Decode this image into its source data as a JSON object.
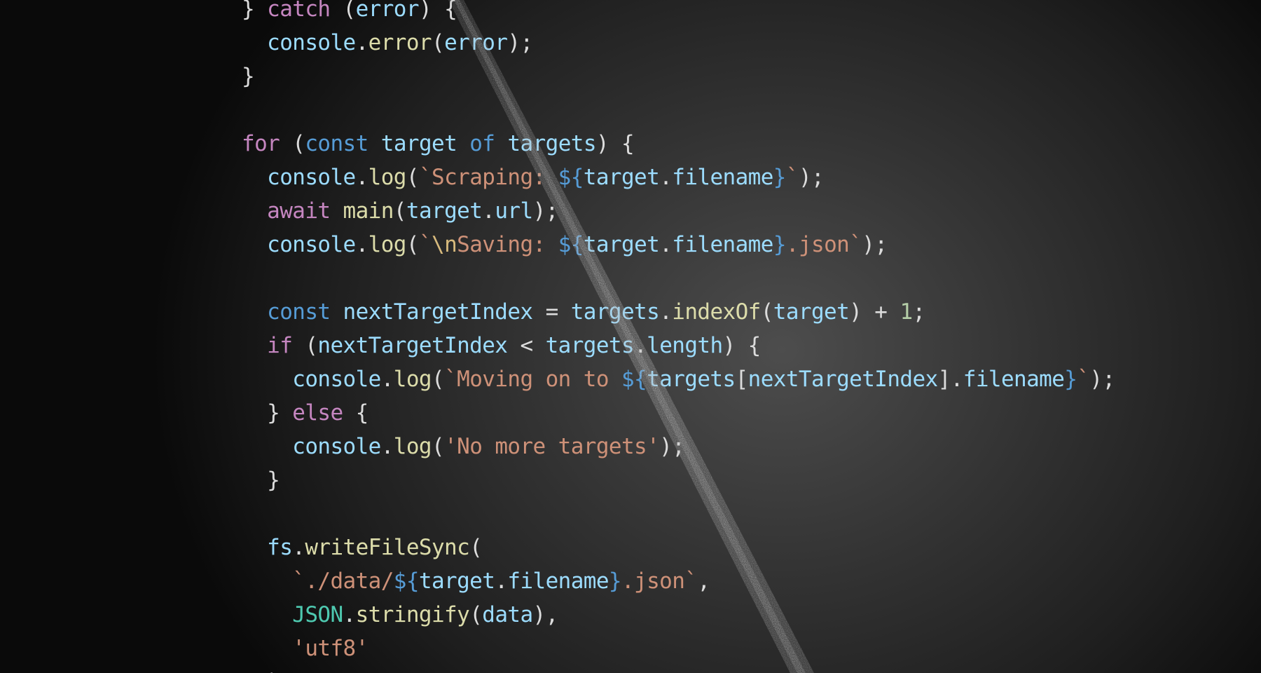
{
  "code_lines": [
    [
      {
        "t": "} ",
        "c": "plain"
      },
      {
        "t": "catch",
        "c": "kw"
      },
      {
        "t": " (",
        "c": "plain"
      },
      {
        "t": "error",
        "c": "var"
      },
      {
        "t": ") {",
        "c": "plain"
      }
    ],
    [
      {
        "t": "  ",
        "c": "plain"
      },
      {
        "t": "console",
        "c": "var"
      },
      {
        "t": ".",
        "c": "plain"
      },
      {
        "t": "error",
        "c": "fn"
      },
      {
        "t": "(",
        "c": "plain"
      },
      {
        "t": "error",
        "c": "var"
      },
      {
        "t": ");",
        "c": "plain"
      }
    ],
    [
      {
        "t": "}",
        "c": "plain"
      }
    ],
    [],
    [
      {
        "t": "for",
        "c": "kw"
      },
      {
        "t": " (",
        "c": "plain"
      },
      {
        "t": "const",
        "c": "decl"
      },
      {
        "t": " ",
        "c": "plain"
      },
      {
        "t": "target",
        "c": "var"
      },
      {
        "t": " ",
        "c": "plain"
      },
      {
        "t": "of",
        "c": "decl"
      },
      {
        "t": " ",
        "c": "plain"
      },
      {
        "t": "targets",
        "c": "var"
      },
      {
        "t": ") {",
        "c": "plain"
      }
    ],
    [
      {
        "t": "  ",
        "c": "plain"
      },
      {
        "t": "console",
        "c": "var"
      },
      {
        "t": ".",
        "c": "plain"
      },
      {
        "t": "log",
        "c": "fn"
      },
      {
        "t": "(",
        "c": "plain"
      },
      {
        "t": "`Scraping: ",
        "c": "str"
      },
      {
        "t": "${",
        "c": "interp"
      },
      {
        "t": "target",
        "c": "var"
      },
      {
        "t": ".",
        "c": "plain"
      },
      {
        "t": "filename",
        "c": "var"
      },
      {
        "t": "}",
        "c": "interp"
      },
      {
        "t": "`",
        "c": "str"
      },
      {
        "t": ");",
        "c": "plain"
      }
    ],
    [
      {
        "t": "  ",
        "c": "plain"
      },
      {
        "t": "await",
        "c": "kw"
      },
      {
        "t": " ",
        "c": "plain"
      },
      {
        "t": "main",
        "c": "fn"
      },
      {
        "t": "(",
        "c": "plain"
      },
      {
        "t": "target",
        "c": "var"
      },
      {
        "t": ".",
        "c": "plain"
      },
      {
        "t": "url",
        "c": "var"
      },
      {
        "t": ");",
        "c": "plain"
      }
    ],
    [
      {
        "t": "  ",
        "c": "plain"
      },
      {
        "t": "console",
        "c": "var"
      },
      {
        "t": ".",
        "c": "plain"
      },
      {
        "t": "log",
        "c": "fn"
      },
      {
        "t": "(",
        "c": "plain"
      },
      {
        "t": "`",
        "c": "str"
      },
      {
        "t": "\\n",
        "c": "esc"
      },
      {
        "t": "Saving: ",
        "c": "str"
      },
      {
        "t": "${",
        "c": "interp"
      },
      {
        "t": "target",
        "c": "var"
      },
      {
        "t": ".",
        "c": "plain"
      },
      {
        "t": "filename",
        "c": "var"
      },
      {
        "t": "}",
        "c": "interp"
      },
      {
        "t": ".json`",
        "c": "str"
      },
      {
        "t": ");",
        "c": "plain"
      }
    ],
    [],
    [
      {
        "t": "  ",
        "c": "plain"
      },
      {
        "t": "const",
        "c": "decl"
      },
      {
        "t": " ",
        "c": "plain"
      },
      {
        "t": "nextTargetIndex",
        "c": "var"
      },
      {
        "t": " = ",
        "c": "plain"
      },
      {
        "t": "targets",
        "c": "var"
      },
      {
        "t": ".",
        "c": "plain"
      },
      {
        "t": "indexOf",
        "c": "fn"
      },
      {
        "t": "(",
        "c": "plain"
      },
      {
        "t": "target",
        "c": "var"
      },
      {
        "t": ") + ",
        "c": "plain"
      },
      {
        "t": "1",
        "c": "num"
      },
      {
        "t": ";",
        "c": "plain"
      }
    ],
    [
      {
        "t": "  ",
        "c": "plain"
      },
      {
        "t": "if",
        "c": "kw"
      },
      {
        "t": " (",
        "c": "plain"
      },
      {
        "t": "nextTargetIndex",
        "c": "var"
      },
      {
        "t": " < ",
        "c": "plain"
      },
      {
        "t": "targets",
        "c": "var"
      },
      {
        "t": ".",
        "c": "plain"
      },
      {
        "t": "length",
        "c": "var"
      },
      {
        "t": ") {",
        "c": "plain"
      }
    ],
    [
      {
        "t": "    ",
        "c": "plain"
      },
      {
        "t": "console",
        "c": "var"
      },
      {
        "t": ".",
        "c": "plain"
      },
      {
        "t": "log",
        "c": "fn"
      },
      {
        "t": "(",
        "c": "plain"
      },
      {
        "t": "`Moving on to ",
        "c": "str"
      },
      {
        "t": "${",
        "c": "interp"
      },
      {
        "t": "targets",
        "c": "var"
      },
      {
        "t": "[",
        "c": "plain"
      },
      {
        "t": "nextTargetIndex",
        "c": "var"
      },
      {
        "t": "].",
        "c": "plain"
      },
      {
        "t": "filename",
        "c": "var"
      },
      {
        "t": "}",
        "c": "interp"
      },
      {
        "t": "`",
        "c": "str"
      },
      {
        "t": ");",
        "c": "plain"
      }
    ],
    [
      {
        "t": "  } ",
        "c": "plain"
      },
      {
        "t": "else",
        "c": "kw"
      },
      {
        "t": " {",
        "c": "plain"
      }
    ],
    [
      {
        "t": "    ",
        "c": "plain"
      },
      {
        "t": "console",
        "c": "var"
      },
      {
        "t": ".",
        "c": "plain"
      },
      {
        "t": "log",
        "c": "fn"
      },
      {
        "t": "(",
        "c": "plain"
      },
      {
        "t": "'No more targets'",
        "c": "str"
      },
      {
        "t": ");",
        "c": "plain"
      }
    ],
    [
      {
        "t": "  }",
        "c": "plain"
      }
    ],
    [],
    [
      {
        "t": "  ",
        "c": "plain"
      },
      {
        "t": "fs",
        "c": "var"
      },
      {
        "t": ".",
        "c": "plain"
      },
      {
        "t": "writeFileSync",
        "c": "fn"
      },
      {
        "t": "(",
        "c": "plain"
      }
    ],
    [
      {
        "t": "    ",
        "c": "plain"
      },
      {
        "t": "`./data/",
        "c": "str"
      },
      {
        "t": "${",
        "c": "interp"
      },
      {
        "t": "target",
        "c": "var"
      },
      {
        "t": ".",
        "c": "plain"
      },
      {
        "t": "filename",
        "c": "var"
      },
      {
        "t": "}",
        "c": "interp"
      },
      {
        "t": ".json`",
        "c": "str"
      },
      {
        "t": ",",
        "c": "plain"
      }
    ],
    [
      {
        "t": "    ",
        "c": "plain"
      },
      {
        "t": "JSON",
        "c": "cls"
      },
      {
        "t": ".",
        "c": "plain"
      },
      {
        "t": "stringify",
        "c": "fn"
      },
      {
        "t": "(",
        "c": "plain"
      },
      {
        "t": "data",
        "c": "var"
      },
      {
        "t": "),",
        "c": "plain"
      }
    ],
    [
      {
        "t": "    ",
        "c": "plain"
      },
      {
        "t": "'utf8'",
        "c": "str"
      }
    ],
    [
      {
        "t": "  );",
        "c": "plain"
      }
    ]
  ]
}
